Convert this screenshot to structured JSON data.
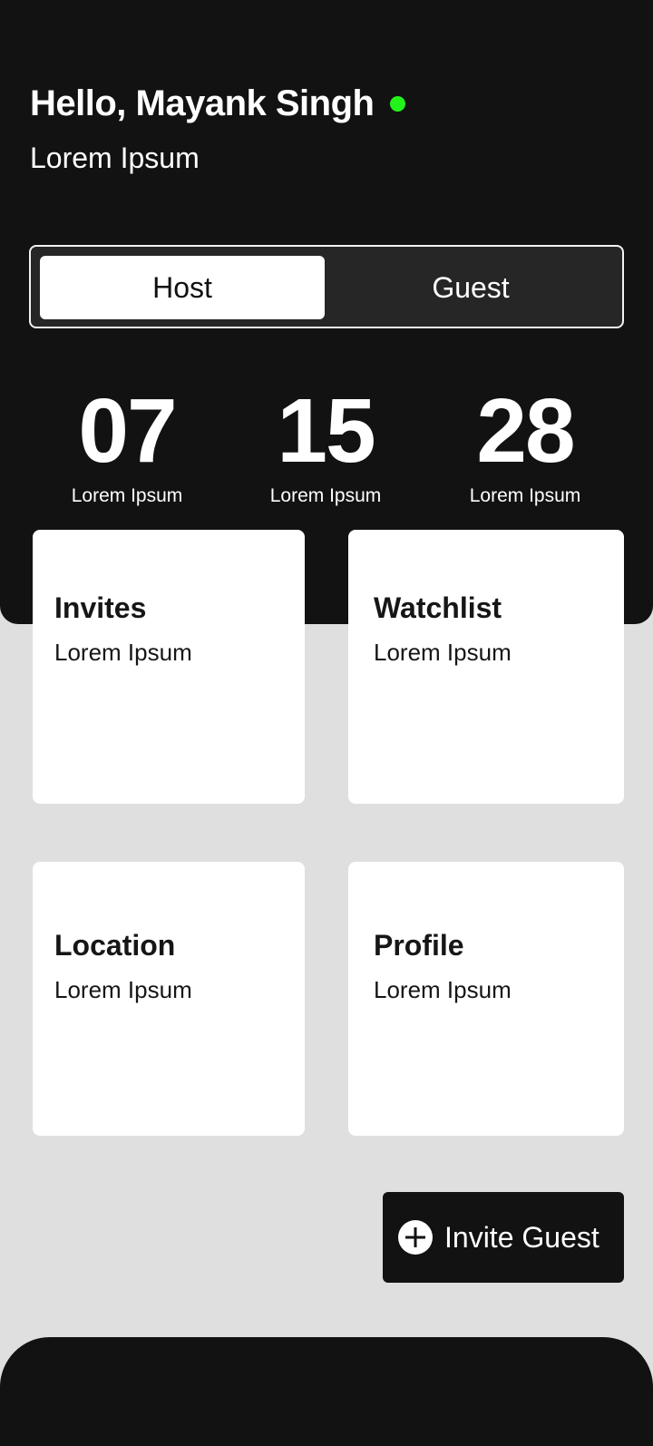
{
  "header": {
    "greeting": "Hello, Mayank Singh",
    "subtitle": "Lorem Ipsum",
    "status_color": "#22f21a"
  },
  "toggle": {
    "options": [
      "Host",
      "Guest"
    ],
    "selected": "Host"
  },
  "stats": [
    {
      "value": "07",
      "label": "Lorem Ipsum"
    },
    {
      "value": "15",
      "label": "Lorem Ipsum"
    },
    {
      "value": "28",
      "label": "Lorem Ipsum"
    }
  ],
  "cards": [
    {
      "title": "Invites",
      "subtitle": "Lorem Ipsum"
    },
    {
      "title": "Watchlist",
      "subtitle": "Lorem Ipsum"
    },
    {
      "title": "Location",
      "subtitle": "Lorem Ipsum"
    },
    {
      "title": "Profile",
      "subtitle": "Lorem Ipsum"
    }
  ],
  "invite_button": {
    "label": "Invite Guest",
    "icon": "plus-circle-icon"
  },
  "colors": {
    "dark": "#121212",
    "background": "#dfdfdf",
    "card": "#ffffff"
  }
}
